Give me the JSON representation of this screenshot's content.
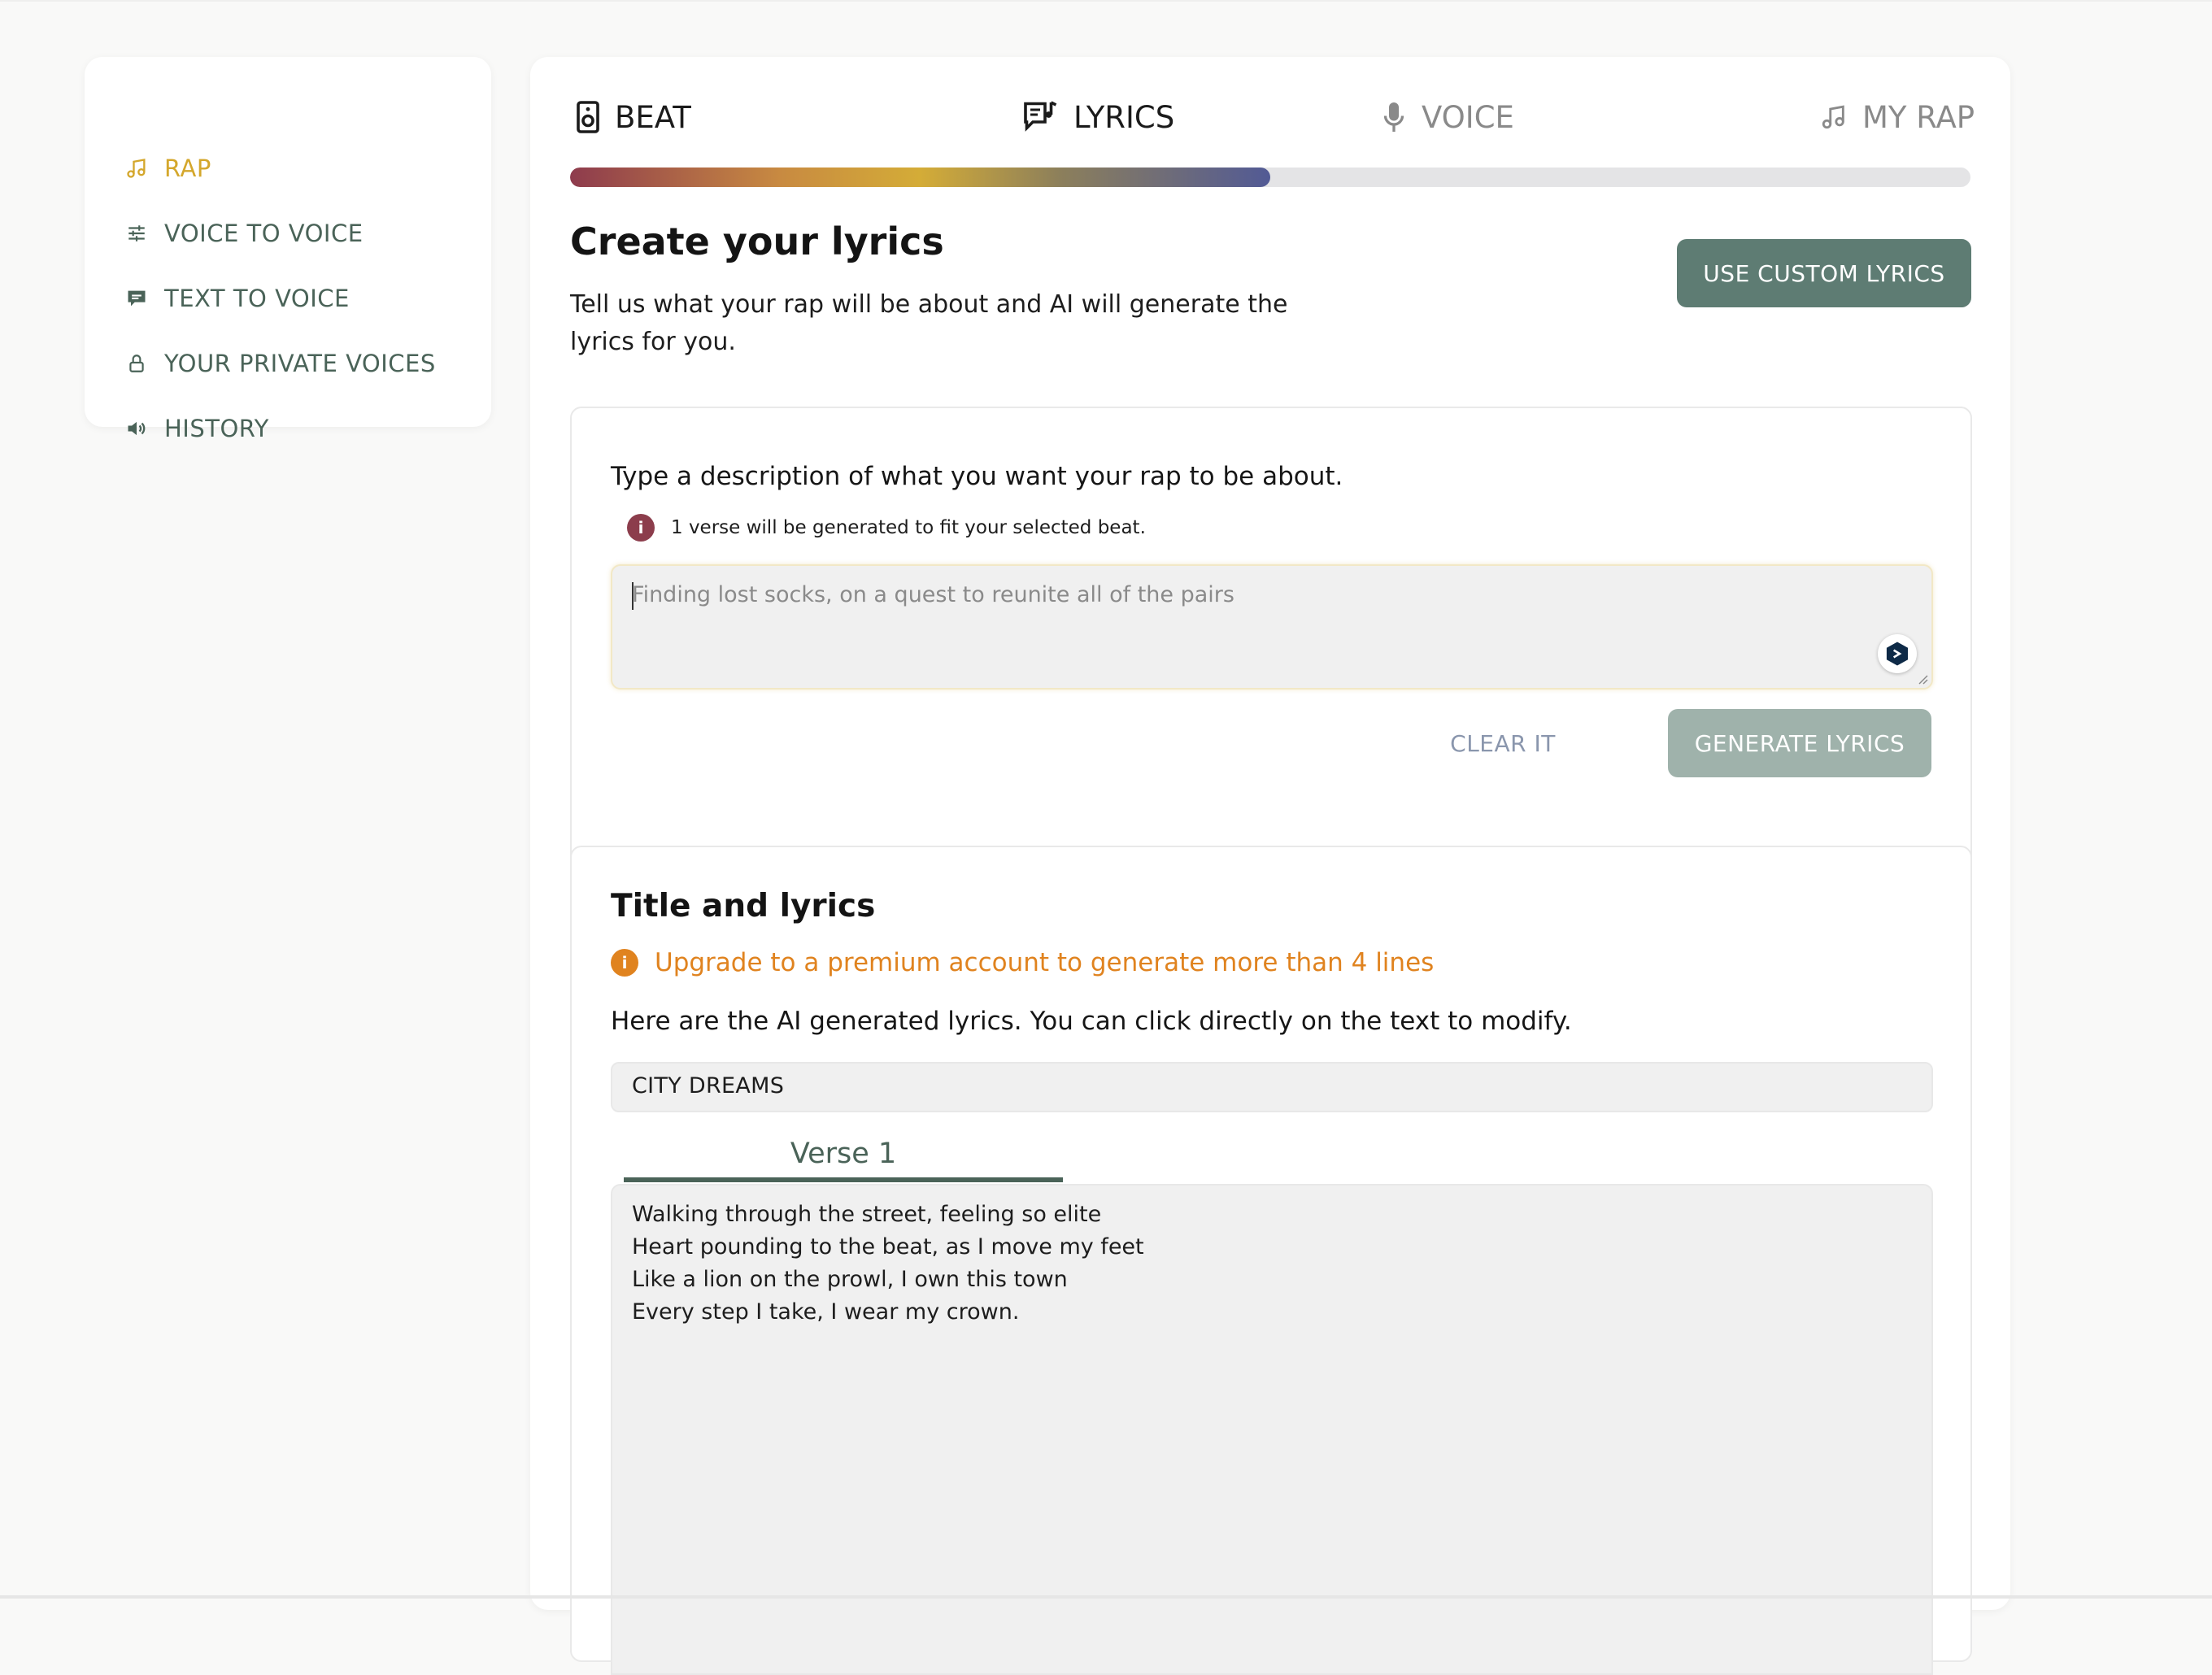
{
  "sidebar": {
    "items": [
      {
        "label": "RAP",
        "icon": "music-note-icon",
        "active": true
      },
      {
        "label": "VOICE TO VOICE",
        "icon": "sliders-icon",
        "active": false
      },
      {
        "label": "TEXT TO VOICE",
        "icon": "chat-bubble-icon",
        "active": false
      },
      {
        "label": "YOUR PRIVATE VOICES",
        "icon": "lock-icon",
        "active": false
      },
      {
        "label": "HISTORY",
        "icon": "speaker-icon",
        "active": false
      }
    ]
  },
  "steps": [
    {
      "label": "BEAT",
      "icon": "speaker-box-icon"
    },
    {
      "label": "LYRICS",
      "icon": "lyrics-icon"
    },
    {
      "label": "VOICE",
      "icon": "microphone-icon"
    },
    {
      "label": "MY RAP",
      "icon": "music-note-icon"
    }
  ],
  "progress": {
    "value": 0.5
  },
  "header": {
    "title": "Create your lyrics",
    "subtitle": "Tell us what your rap will be about and AI will generate the lyrics for you.",
    "custom_button": "USE CUSTOM LYRICS"
  },
  "description_panel": {
    "label": "Type a description of what you want your rap to be about.",
    "note": "1 verse will be generated to fit your selected beat.",
    "placeholder": "Finding lost socks, on a quest to reunite all of the pairs",
    "clear_button": "CLEAR IT",
    "generate_button": "GENERATE LYRICS"
  },
  "lyrics_panel": {
    "title": "Title and lyrics",
    "warning": "Upgrade to a premium account to generate more than 4 lines",
    "description": "Here are the AI generated lyrics. You can click directly on the text to modify.",
    "song_title": "CITY DREAMS",
    "tabs": [
      {
        "label": "Verse 1"
      }
    ],
    "lines": [
      "Walking through the street, feeling so elite",
      "Heart pounding to the beat, as I move my feet",
      "Like a lion on the prowl, I own this town",
      "Every step I take, I wear my crown."
    ]
  },
  "colors": {
    "accent_active": "#d4a72c",
    "primary_green": "#5e7c73",
    "sidebar_text": "#4a6358",
    "warning_orange": "#e0831f",
    "info_red": "#8c3d4c"
  }
}
